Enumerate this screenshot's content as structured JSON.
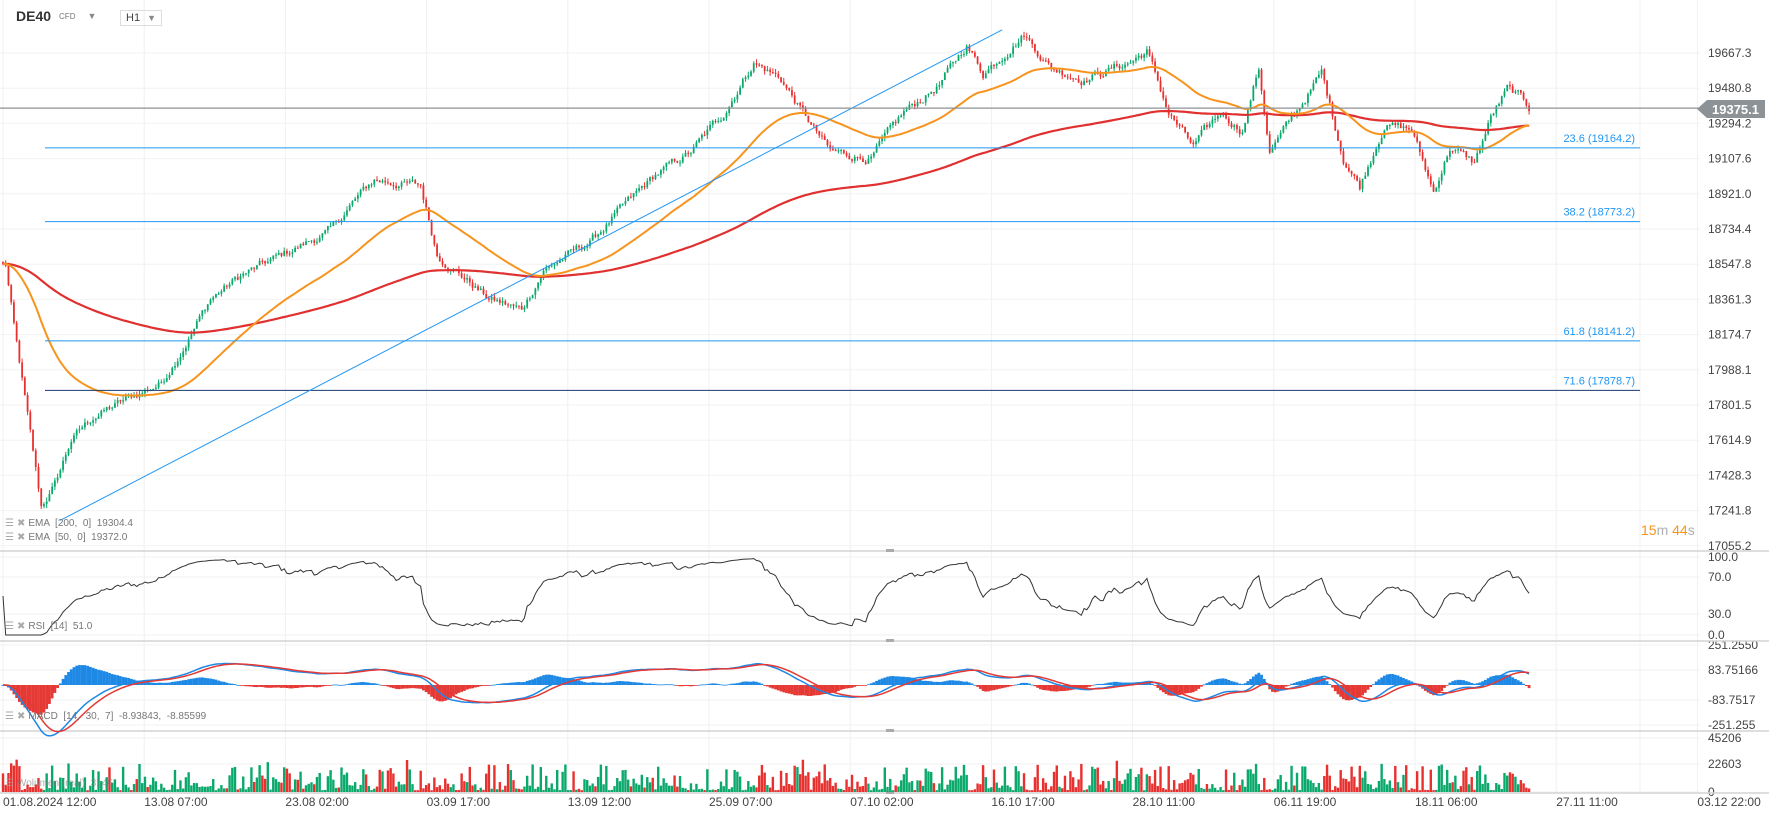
{
  "header": {
    "symbol": "DE40",
    "type": "CFD",
    "timeframe": "H1"
  },
  "current_price": "19375.1",
  "countdown": {
    "min": "15",
    "min_unit": "m",
    "sec": "44",
    "sec_unit": "s"
  },
  "indicators": {
    "ema200": "EMA  [200,  0]  19304.4",
    "ema50": "EMA  [50,  0]  19372.0",
    "rsi": "RSI  [14]  51.0",
    "macd": "MACD  [14,  30,  7]  -8.93843,  -8.85599",
    "volume": "Wolumen (real)  3146"
  },
  "colors": {
    "up": "#0aa86b",
    "down": "#e8302f",
    "ema50": "#f7941d",
    "ema200": "#e03030",
    "fib": "#2196f3",
    "macd": "#1e88e5",
    "signal": "#e53935"
  },
  "chart_data": {
    "type": "candlestick",
    "price_axis": [
      "19667.3",
      "19480.8",
      "19294.2",
      "19107.6",
      "18921.0",
      "18734.4",
      "18547.8",
      "18361.3",
      "18174.7",
      "17988.1",
      "17801.5",
      "17614.9",
      "17428.3",
      "17241.8",
      "17055.2"
    ],
    "rsi_axis": [
      "100.0",
      "70.0",
      "30.0",
      "0.0"
    ],
    "macd_axis": [
      "251.2550",
      "83.75166",
      "-83.7517",
      "-251.255"
    ],
    "volume_axis": [
      "45206",
      "22603",
      "0"
    ],
    "time_labels": [
      "01.08.2024  12:00",
      "13.08  07:00",
      "23.08  02:00",
      "03.09  17:00",
      "13.09  12:00",
      "25.09  07:00",
      "07.10  02:00",
      "16.10  17:00",
      "28.10  11:00",
      "06.11  19:00",
      "18.11  06:00",
      "27.11  11:00",
      "03.12  22:00"
    ],
    "fib_levels": [
      {
        "label": "23.6 (19164.2)",
        "price": 19164.2
      },
      {
        "label": "38.2 (18773.2)",
        "price": 18773.2
      },
      {
        "label": "61.8 (18141.2)",
        "price": 18141.2
      },
      {
        "label": "71.6 (17878.7)",
        "price": 17878.7
      }
    ],
    "trendline": {
      "from": {
        "bar": 21,
        "price": 17190
      },
      "to": {
        "bar": 366,
        "price": 19790
      }
    },
    "bars": 560,
    "close_keypoints": [
      [
        1,
        18543
      ],
      [
        4,
        18215
      ],
      [
        9,
        17738
      ],
      [
        14,
        17260
      ],
      [
        19,
        17377
      ],
      [
        25,
        17616
      ],
      [
        33,
        17738
      ],
      [
        45,
        17828
      ],
      [
        58,
        17918
      ],
      [
        68,
        18157
      ],
      [
        76,
        18363
      ],
      [
        87,
        18485
      ],
      [
        103,
        18602
      ],
      [
        120,
        18724
      ],
      [
        128,
        18872
      ],
      [
        136,
        18994
      ],
      [
        153,
        18962
      ],
      [
        159,
        18602
      ],
      [
        173,
        18427
      ],
      [
        178,
        18363
      ],
      [
        190,
        18305
      ],
      [
        198,
        18517
      ],
      [
        215,
        18665
      ],
      [
        227,
        18845
      ],
      [
        239,
        19020
      ],
      [
        252,
        19142
      ],
      [
        264,
        19349
      ],
      [
        275,
        19620
      ],
      [
        285,
        19530
      ],
      [
        293,
        19349
      ],
      [
        303,
        19142
      ],
      [
        318,
        19110
      ],
      [
        330,
        19349
      ],
      [
        343,
        19498
      ],
      [
        353,
        19710
      ],
      [
        359,
        19561
      ],
      [
        374,
        19768
      ],
      [
        384,
        19588
      ],
      [
        396,
        19530
      ],
      [
        413,
        19620
      ],
      [
        419,
        19678
      ],
      [
        427,
        19349
      ],
      [
        436,
        19169
      ],
      [
        446,
        19349
      ],
      [
        454,
        19259
      ],
      [
        460,
        19588
      ],
      [
        464,
        19142
      ],
      [
        475,
        19381
      ],
      [
        483,
        19561
      ],
      [
        491,
        19110
      ],
      [
        497,
        18962
      ],
      [
        506,
        19291
      ],
      [
        516,
        19259
      ],
      [
        524,
        18930
      ],
      [
        530,
        19169
      ],
      [
        539,
        19084
      ],
      [
        545,
        19323
      ],
      [
        551,
        19471
      ],
      [
        555,
        19440
      ],
      [
        559,
        19375
      ]
    ]
  }
}
